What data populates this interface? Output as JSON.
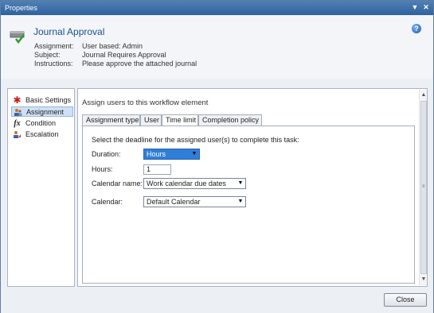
{
  "window": {
    "title": "Properties"
  },
  "header": {
    "title": "Journal Approval",
    "assignment_label": "Assignment:",
    "assignment_value": "User based: Admin",
    "subject_label": "Subject:",
    "subject_value": "Journal Requires Approval",
    "instructions_label": "Instructions:",
    "instructions_value": "Please approve the attached journal",
    "help_glyph": "?"
  },
  "sidebar": {
    "items": [
      {
        "label": "Basic Settings",
        "icon": "red-star-icon"
      },
      {
        "label": "Assignment",
        "icon": "users-icon",
        "selected": true
      },
      {
        "label": "Condition",
        "icon": "fx-icon"
      },
      {
        "label": "Escalation",
        "icon": "escalation-icon"
      }
    ]
  },
  "content": {
    "section_title": "Assign users to this workflow element",
    "tabs": [
      {
        "label": "Assignment type"
      },
      {
        "label": "User"
      },
      {
        "label": "Time limit",
        "active": true
      },
      {
        "label": "Completion policy"
      }
    ],
    "instruction": "Select the deadline for the assigned user(s)  to complete this task:",
    "fields": {
      "duration_label": "Duration:",
      "duration_value": "Hours",
      "hours_label": "Hours:",
      "hours_value": "1",
      "calendar_name_label": "Calendar name:",
      "calendar_name_value": "Work calendar due dates",
      "calendar_label": "Calendar:",
      "calendar_value": "Default Calendar"
    }
  },
  "footer": {
    "close_label": "Close"
  },
  "colors": {
    "titlebar": "#3a6ea8",
    "accent": "#2f7fd8",
    "header_title": "#1d4f91"
  }
}
